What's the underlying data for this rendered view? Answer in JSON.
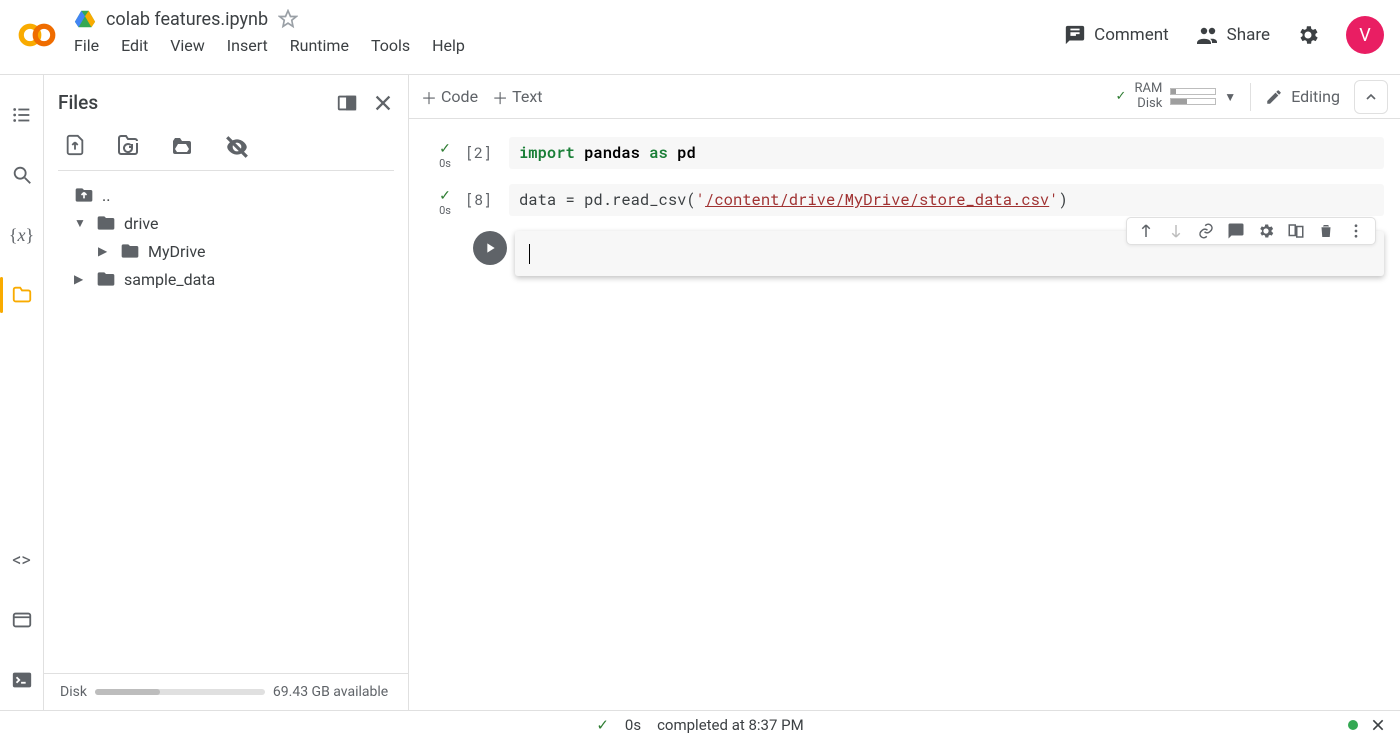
{
  "header": {
    "notebook_title": "colab features.ipynb",
    "avatar_letter": "V"
  },
  "header_actions": {
    "comment": "Comment",
    "share": "Share"
  },
  "menu": {
    "file": "File",
    "edit": "Edit",
    "view": "View",
    "insert": "Insert",
    "runtime": "Runtime",
    "tools": "Tools",
    "help": "Help"
  },
  "files_panel": {
    "title": "Files",
    "disk_label": "Disk",
    "disk_available": "69.43 GB available",
    "tree": {
      "up": "..",
      "drive": "drive",
      "mydrive": "MyDrive",
      "sample_data": "sample_data"
    }
  },
  "nb_toolbar": {
    "add_code": "Code",
    "add_text": "Text",
    "ram_label": "RAM",
    "disk_label": "Disk",
    "editing": "Editing"
  },
  "cells": {
    "c1": {
      "prompt": "[2]",
      "exec_time": "0s",
      "tok_import": "import",
      "tok_pandas": "pandas",
      "tok_as": "as",
      "tok_pd": "pd"
    },
    "c2": {
      "prompt": "[8]",
      "exec_time": "0s",
      "before": "data = pd.read_csv(",
      "quote": "'",
      "path": "/content/drive/MyDrive/store_data.csv",
      "after": ")"
    }
  },
  "statusbar": {
    "time": "0s",
    "message": "completed at 8:37 PM"
  }
}
